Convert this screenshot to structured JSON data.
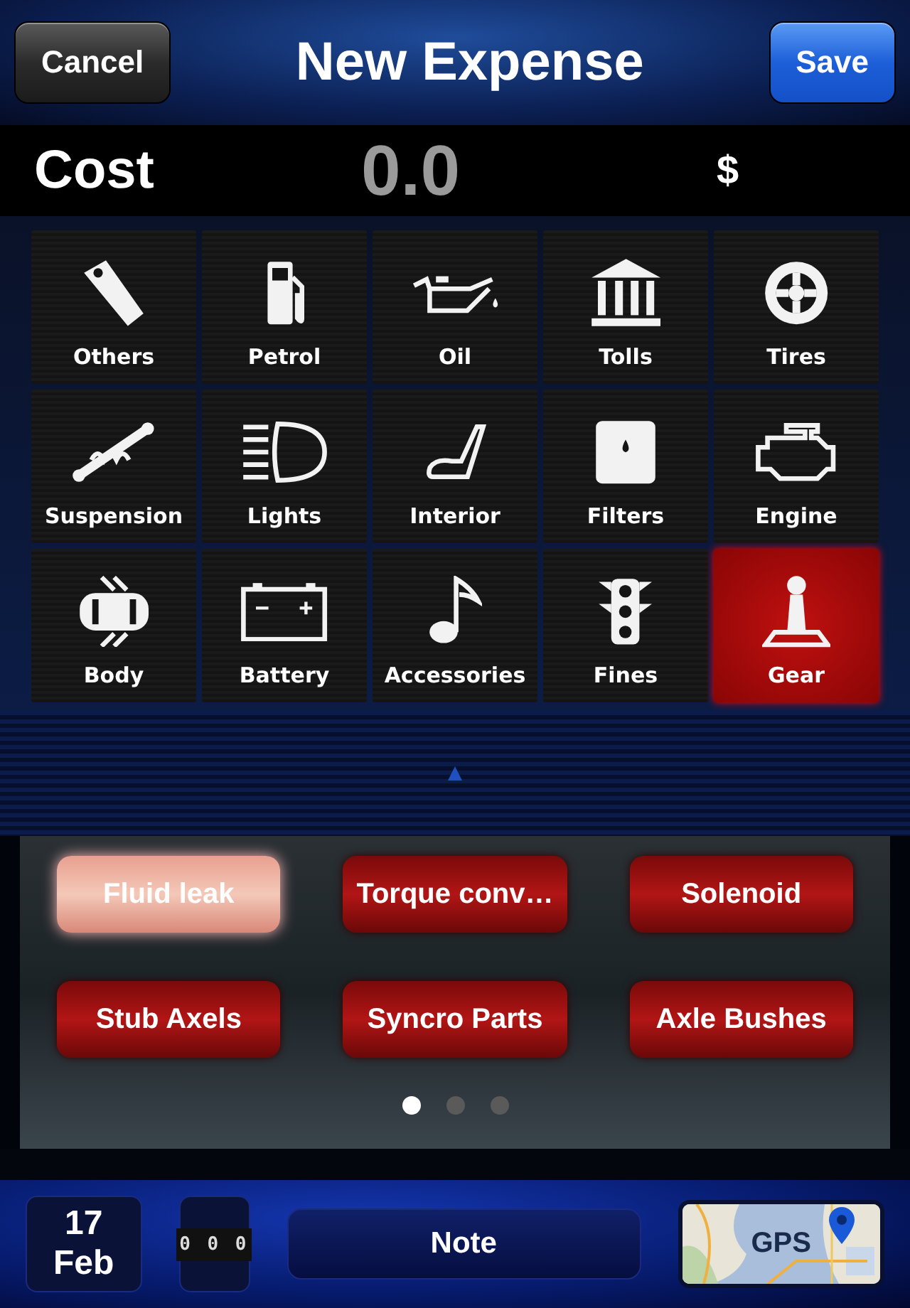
{
  "header": {
    "cancel": "Cancel",
    "title": "New Expense",
    "save": "Save"
  },
  "cost": {
    "label": "Cost",
    "value": "0.0",
    "currency": "$"
  },
  "categories": [
    {
      "label": "Others",
      "selected": false
    },
    {
      "label": "Petrol",
      "selected": false
    },
    {
      "label": "Oil",
      "selected": false
    },
    {
      "label": "Tolls",
      "selected": false
    },
    {
      "label": "Tires",
      "selected": false
    },
    {
      "label": "Suspension",
      "selected": false
    },
    {
      "label": "Lights",
      "selected": false
    },
    {
      "label": "Interior",
      "selected": false
    },
    {
      "label": "Filters",
      "selected": false
    },
    {
      "label": "Engine",
      "selected": false
    },
    {
      "label": "Body",
      "selected": false
    },
    {
      "label": "Battery",
      "selected": false
    },
    {
      "label": "Accessories",
      "selected": false
    },
    {
      "label": "Fines",
      "selected": false
    },
    {
      "label": "Gear",
      "selected": true
    }
  ],
  "subcategories": [
    {
      "label": "Fluid leak",
      "selected": true
    },
    {
      "label": "Torque conv…",
      "selected": false
    },
    {
      "label": "Solenoid",
      "selected": false
    },
    {
      "label": "Stub Axels",
      "selected": false
    },
    {
      "label": "Syncro Parts",
      "selected": false
    },
    {
      "label": "Axle Bushes",
      "selected": false
    }
  ],
  "pages": [
    {
      "selected": true
    },
    {
      "selected": false
    },
    {
      "selected": false
    }
  ],
  "bottom_bar": {
    "day": "17",
    "month": "Feb",
    "odometer": [
      "0",
      "0",
      "0"
    ],
    "note": "Note",
    "gps": "GPS"
  }
}
